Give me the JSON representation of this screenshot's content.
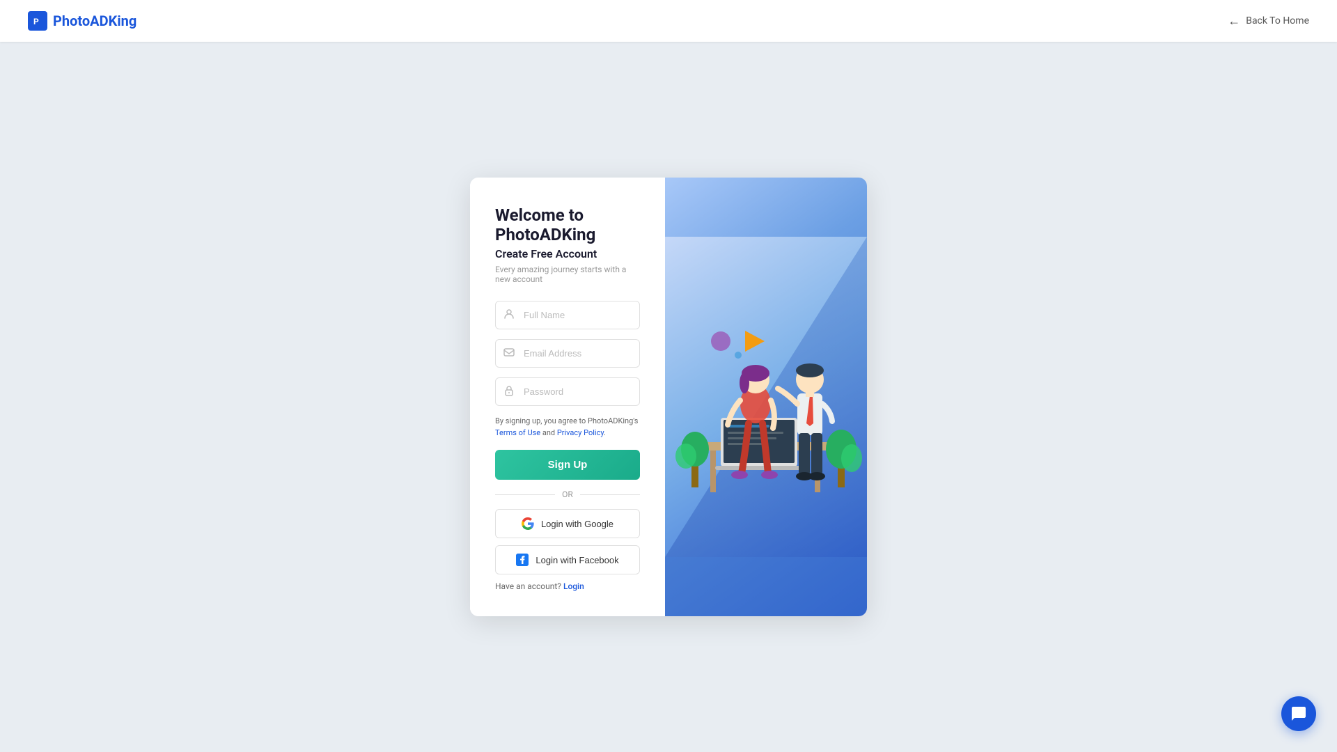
{
  "header": {
    "logo_text": "PhotoADKing",
    "logo_icon_text": "🅿",
    "back_home_label": "Back To Home"
  },
  "form": {
    "welcome_title": "Welcome to PhotoADKing",
    "create_account_label": "Create Free Account",
    "subtitle": "Every amazing journey starts with a new account",
    "fullname_placeholder": "Full Name",
    "email_placeholder": "Email Address",
    "password_placeholder": "Password",
    "terms_prefix": "By signing up, you agree to PhotoADKing's ",
    "terms_link_label": "Terms of Use",
    "terms_middle": " and ",
    "privacy_link_label": "Privacy Policy",
    "terms_suffix": ".",
    "signup_button": "Sign Up",
    "or_label": "OR",
    "google_button": "Login with Google",
    "facebook_button": "Login with Facebook",
    "have_account_prefix": "Have an account? ",
    "login_link": "Login"
  },
  "colors": {
    "primary_blue": "#1a56db",
    "teal": "#2ec4a0",
    "facebook_blue": "#1877f2",
    "google_red": "#ea4335",
    "google_blue": "#4285f4",
    "google_green": "#34a853",
    "google_yellow": "#fbbc05"
  },
  "chat_button": {
    "icon": "💬"
  }
}
